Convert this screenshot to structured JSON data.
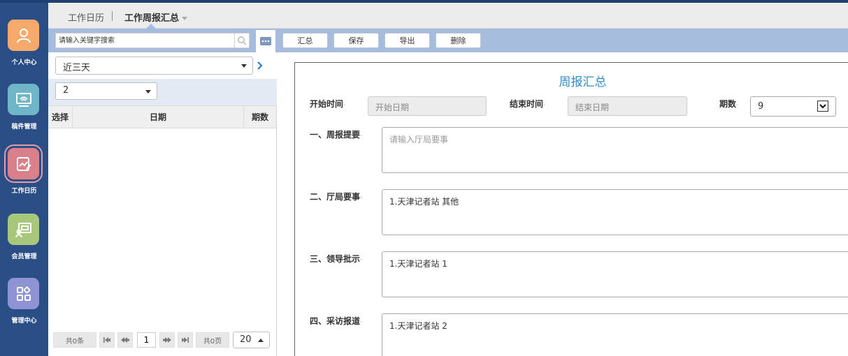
{
  "sidebar": {
    "items": [
      {
        "label": "个人中心",
        "color": "#f5a96b",
        "icon": "user-icon"
      },
      {
        "label": "稿件管理",
        "color": "#6fb7c8",
        "icon": "monitor-icon"
      },
      {
        "label": "工作日历",
        "color": "#d9808b",
        "icon": "edit-chart-icon"
      },
      {
        "label": "会员管理",
        "color": "#a7c87a",
        "icon": "board-icon"
      },
      {
        "label": "管理中心",
        "color": "#8e93d3",
        "icon": "apps-grid-icon"
      }
    ]
  },
  "tabs": {
    "tab1": "工作日历",
    "tab2": "工作周报汇总"
  },
  "left": {
    "search_placeholder": "请输入关键字搜索",
    "range_select": "近三天",
    "count_select": "2",
    "columns": [
      "选择",
      "日期",
      "期数"
    ],
    "pager": {
      "total_records": "共0条",
      "page": "1",
      "total_pages": "共0页",
      "page_size": "20"
    }
  },
  "toolbar": {
    "summary": "汇总",
    "save": "保存",
    "export": "导出",
    "delete": "删除"
  },
  "form": {
    "title": "周报汇总",
    "start_label": "开始时间",
    "start_placeholder": "开始日期",
    "end_label": "结束时间",
    "end_placeholder": "结束日期",
    "period_label": "期数",
    "period_value": "9",
    "sections": [
      {
        "label": "一、周报提要",
        "value": "请输入厅局要事",
        "placeholder": true
      },
      {
        "label": "二、厅局要事",
        "value": "1.天津记者站 其他",
        "placeholder": false
      },
      {
        "label": "三、领导批示",
        "value": "1.天津记者站 1",
        "placeholder": false
      },
      {
        "label": "四、采访报道",
        "value": "1.天津记者站 2",
        "placeholder": false
      }
    ]
  }
}
